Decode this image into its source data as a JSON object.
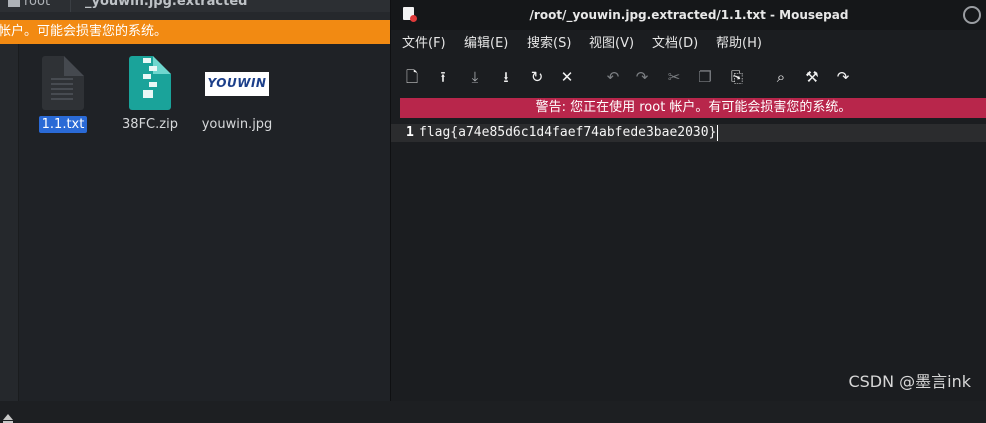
{
  "file_manager": {
    "tabs": [
      {
        "label": "root"
      },
      {
        "label": "_youwin.jpg.extracted"
      }
    ],
    "warning": "帐户。可能会损害您的系统。",
    "files": [
      {
        "name": "1.1.txt",
        "icon": "text-file-icon",
        "selected": true
      },
      {
        "name": "38FC.zip",
        "icon": "zip-archive-icon",
        "selected": false
      },
      {
        "name": "youwin.jpg",
        "icon": "image-thumbnail",
        "thumbnail_text": "YOUWIN",
        "selected": false
      }
    ]
  },
  "editor": {
    "title": "/root/_youwin.jpg.extracted/1.1.txt - Mousepad",
    "menu": [
      "文件(F)",
      "编辑(E)",
      "搜索(S)",
      "视图(V)",
      "文档(D)",
      "帮助(H)"
    ],
    "toolbar_icons": [
      "new-document-icon",
      "open-icon",
      "save-icon",
      "save-as-icon",
      "reload-icon",
      "close-icon",
      "undo-icon",
      "redo-icon",
      "cut-icon",
      "copy-icon",
      "paste-icon",
      "find-icon",
      "find-replace-icon",
      "go-to-icon"
    ],
    "warning": "警告: 您正在使用 root 帐户。有可能会损害您的系统。",
    "lines": [
      {
        "number": "1",
        "text": "flag{a74e85d6c1d4faef74abfede3bae2030}"
      }
    ]
  },
  "watermark": "CSDN @墨言ink",
  "colors": {
    "fm_warning_bg": "#f28a12",
    "editor_warning_bg": "#b8264b",
    "selection": "#2a6ad6",
    "zip_icon": "#1aa39a"
  }
}
